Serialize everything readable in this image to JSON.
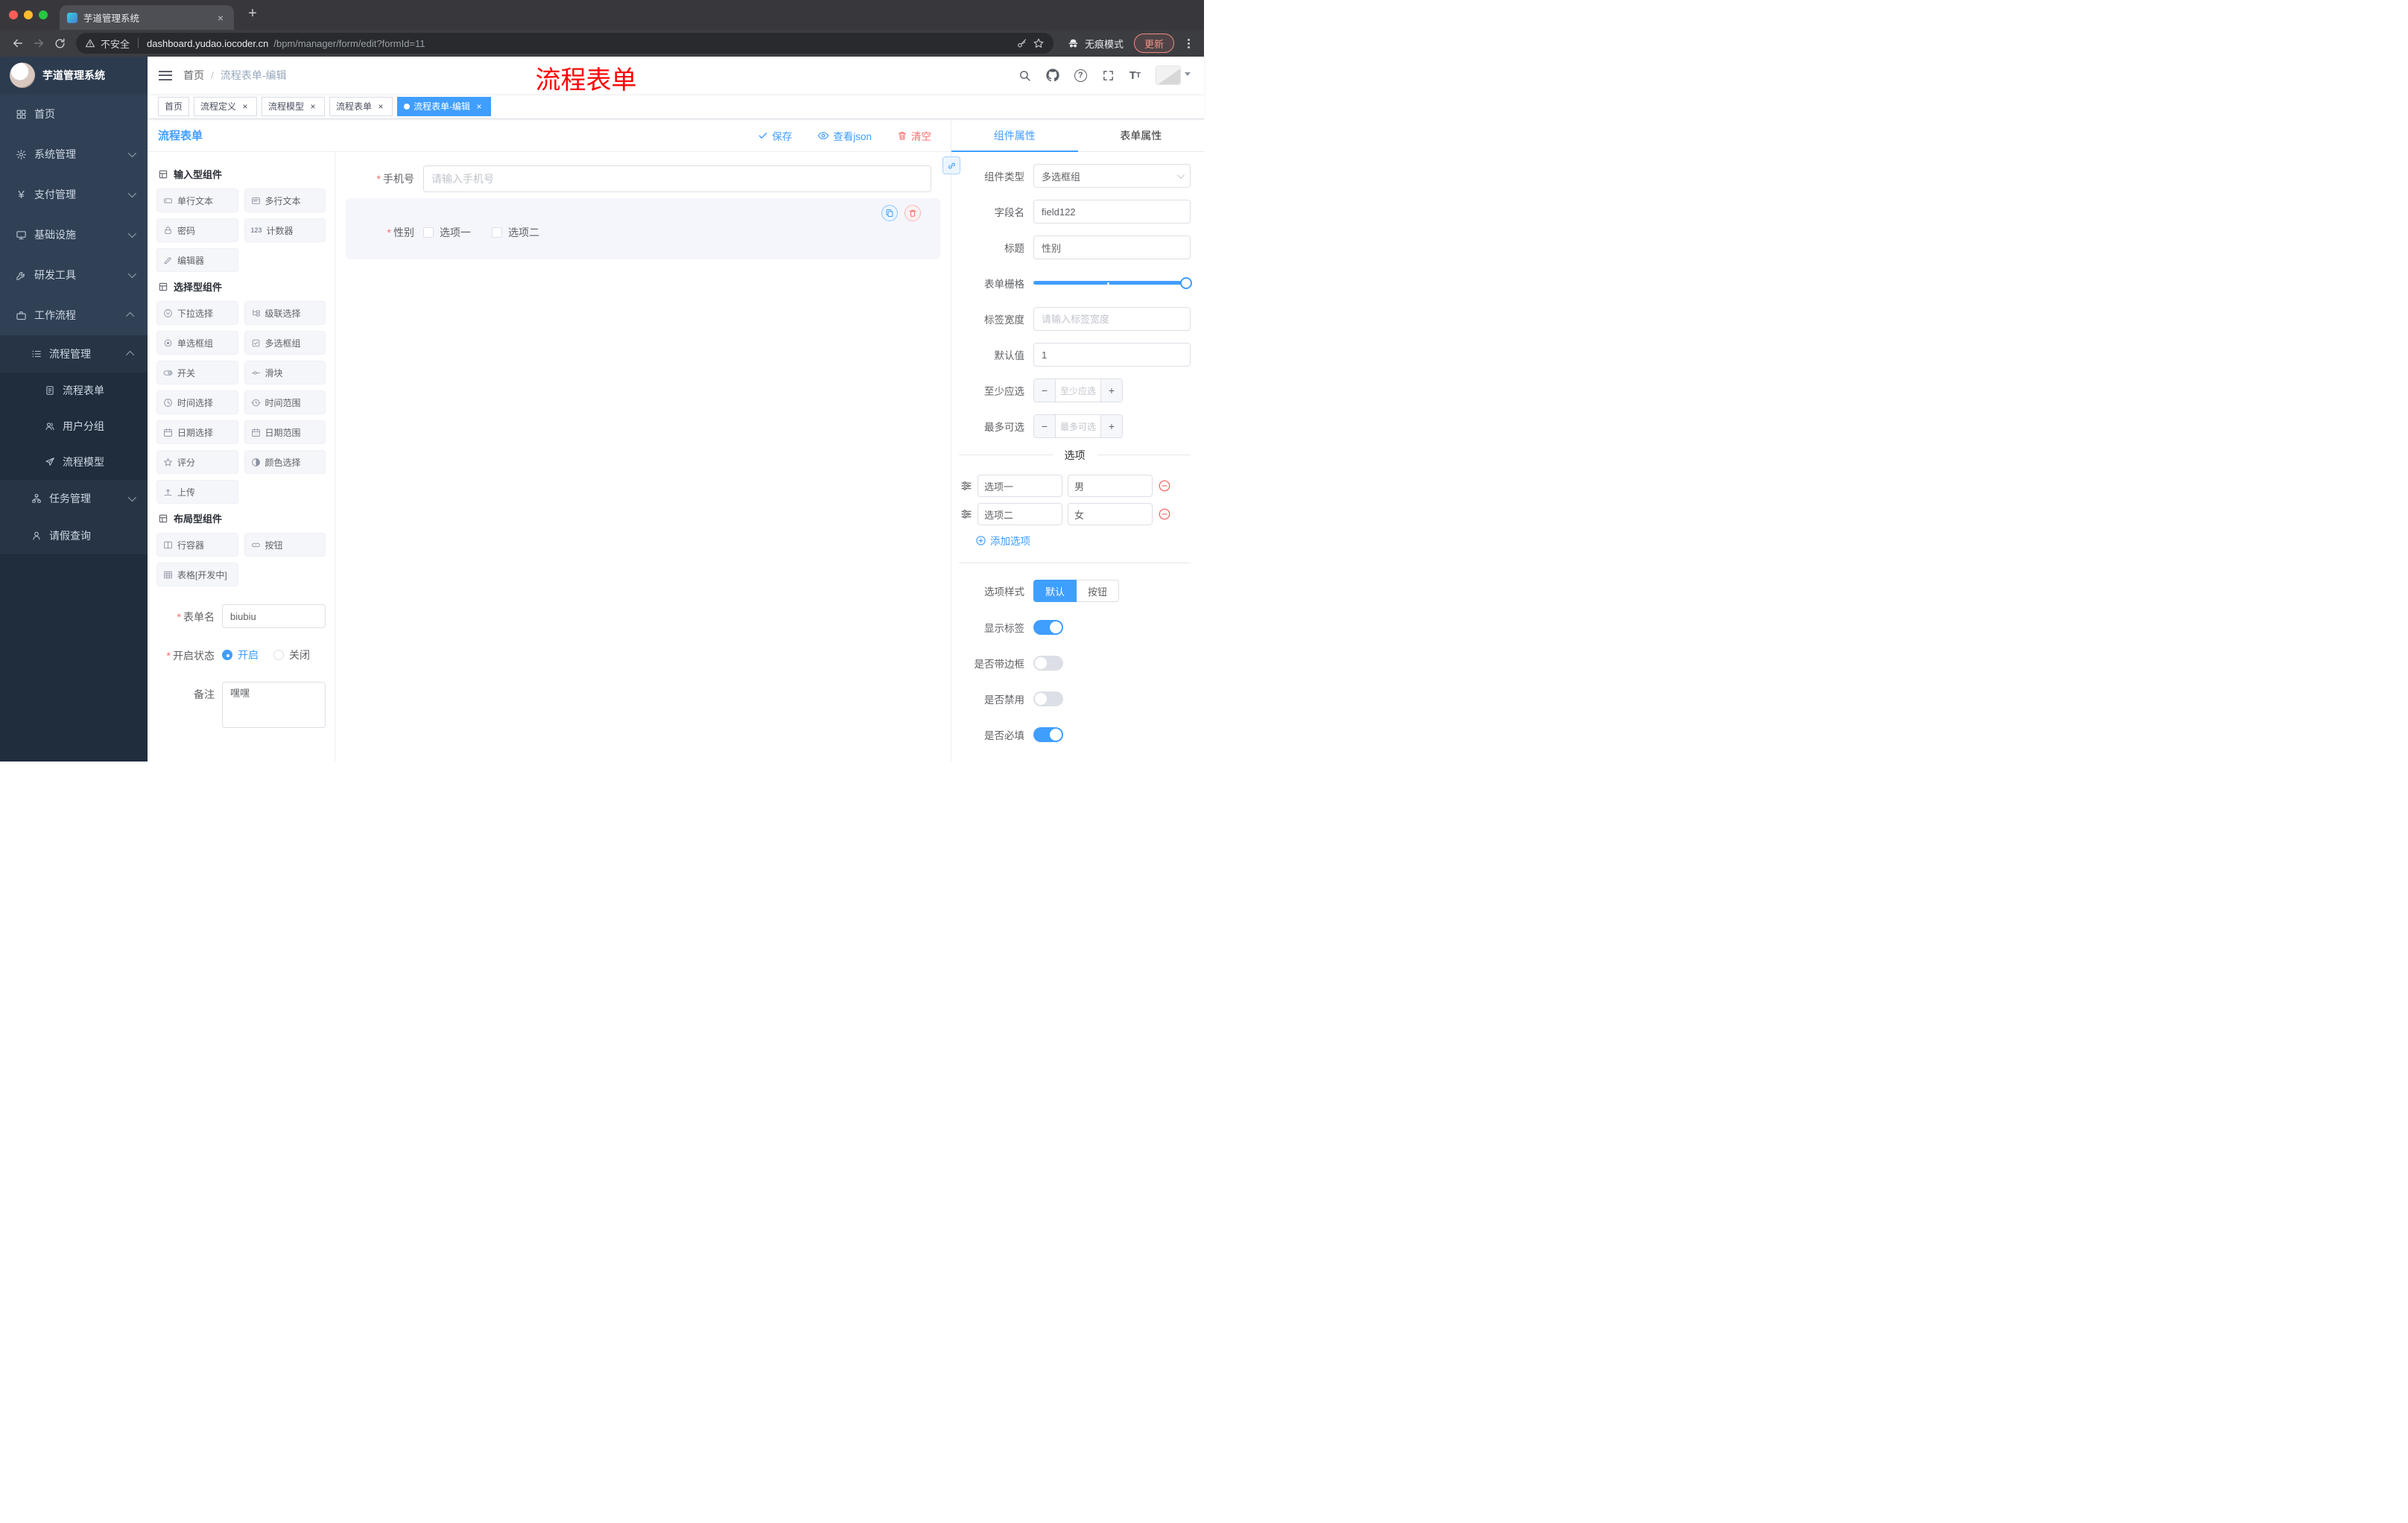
{
  "symbols": {
    "close": "×",
    "plus": "+",
    "slash": "/",
    "required": "*",
    "minus": "−"
  },
  "colors": {
    "accent": "#409eff",
    "danger": "#f56c6c",
    "active_tag": "#409eff",
    "annotation_red": "#fe0000"
  },
  "icon_glyphs": {
    "pay": "¥",
    "help": "?",
    "font_large": "T",
    "font_small": "T",
    "counter": "123"
  },
  "browser": {
    "tab_title": "芋道管理系统",
    "security_label": "不安全",
    "url_host": "dashboard.yudao.iocoder.cn",
    "url_path": "/bpm/manager/form/edit?formId=11",
    "incognito_label": "无痕模式",
    "update_label": "更新"
  },
  "sidebar": {
    "brand": "芋道管理系统",
    "items": [
      {
        "label": "首页"
      },
      {
        "label": "系统管理"
      },
      {
        "label": "支付管理"
      },
      {
        "label": "基础设施"
      },
      {
        "label": "研发工具"
      },
      {
        "label": "工作流程"
      },
      {
        "label": "流程管理"
      },
      {
        "label": "流程表单"
      },
      {
        "label": "用户分组"
      },
      {
        "label": "流程模型"
      },
      {
        "label": "任务管理"
      },
      {
        "label": "请假查询"
      }
    ]
  },
  "navbar": {
    "breadcrumb_home": "首页",
    "breadcrumb_current": "流程表单-编辑",
    "annotation": "流程表单"
  },
  "tags": {
    "items": [
      {
        "label": "首页"
      },
      {
        "label": "流程定义"
      },
      {
        "label": "流程模型"
      },
      {
        "label": "流程表单"
      },
      {
        "label": "流程表单-编辑"
      }
    ]
  },
  "designer": {
    "title": "流程表单",
    "save": "保存",
    "view_json": "查看json",
    "clear": "清空",
    "groups": [
      {
        "title": "输入型组件"
      },
      {
        "title": "选择型组件"
      },
      {
        "title": "布局型组件"
      }
    ],
    "components": {
      "single_text": "单行文本",
      "multi_text": "多行文本",
      "password": "密码",
      "counter": "计数器",
      "editor": "编辑器",
      "select": "下拉选择",
      "cascader": "级联选择",
      "radio_group": "单选框组",
      "checkbox_group": "多选框组",
      "switch": "开关",
      "slider": "滑块",
      "time": "时间选择",
      "time_range": "时间范围",
      "date": "日期选择",
      "date_range": "日期范围",
      "rate": "评分",
      "color": "颜色选择",
      "upload": "上传",
      "row": "行容器",
      "button": "按钮",
      "table": "表格[开发中]"
    },
    "meta": {
      "form_name_label": "表单名",
      "form_name_value": "biubiu",
      "status_label": "开启状态",
      "status_on": "开启",
      "status_off": "关闭",
      "remark_label": "备注",
      "remark_value": "嘿嘿"
    }
  },
  "canvas": {
    "phone_label": "手机号",
    "phone_placeholder": "请输入手机号",
    "gender_label": "性别",
    "gender_option1": "选项一",
    "gender_option2": "选项二"
  },
  "props": {
    "tab_component": "组件属性",
    "tab_form": "表单属性",
    "component_type_label": "组件类型",
    "component_type_value": "多选框组",
    "field_name_label": "字段名",
    "field_name_value": "field122",
    "title_label": "标题",
    "title_value": "性别",
    "grid_label": "表单栅格",
    "label_width_label": "标签宽度",
    "label_width_placeholder": "请输入标签宽度",
    "default_label": "默认值",
    "default_value": "1",
    "min_label": "至少应选",
    "min_placeholder": "至少应选",
    "max_label": "最多可选",
    "max_placeholder": "最多可选",
    "options_divider": "选项",
    "options": [
      {
        "label": "选项一",
        "value": "男"
      },
      {
        "label": "选项二",
        "value": "女"
      }
    ],
    "add_option": "添加选项",
    "option_style_label": "选项样式",
    "style_default": "默认",
    "style_button": "按钮",
    "show_label": "显示标签",
    "border_label": "是否带边框",
    "disabled_label": "是否禁用",
    "required_label": "是否必填"
  }
}
